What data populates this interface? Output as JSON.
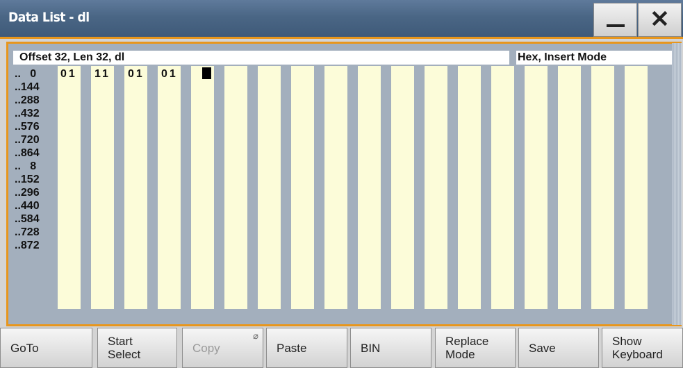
{
  "window": {
    "title": "Data List - dl"
  },
  "header": {
    "info": "Offset 32, Len 32,  dl",
    "mode": "Hex, Insert Mode"
  },
  "rows": [
    "..   0",
    "..144",
    "..288",
    "..432",
    "..576",
    "..720",
    "..864",
    "..   8",
    "..152",
    "..296",
    "..440",
    "..584",
    "..728",
    "..872"
  ],
  "cells": [
    "01",
    "11",
    "01",
    "01"
  ],
  "toolbar": {
    "goto": "GoTo",
    "start_select": "Start\nSelect",
    "copy": "Copy",
    "paste": "Paste",
    "bin": "BIN",
    "replace_mode": "Replace\nMode",
    "save": "Save",
    "show_keyboard": "Show\nKeyboard"
  },
  "colors": {
    "accent": "#e8961c",
    "titlebar": "#4a6685",
    "cell_bg": "#fcfcd9",
    "grid_bg": "#a3afbd"
  }
}
